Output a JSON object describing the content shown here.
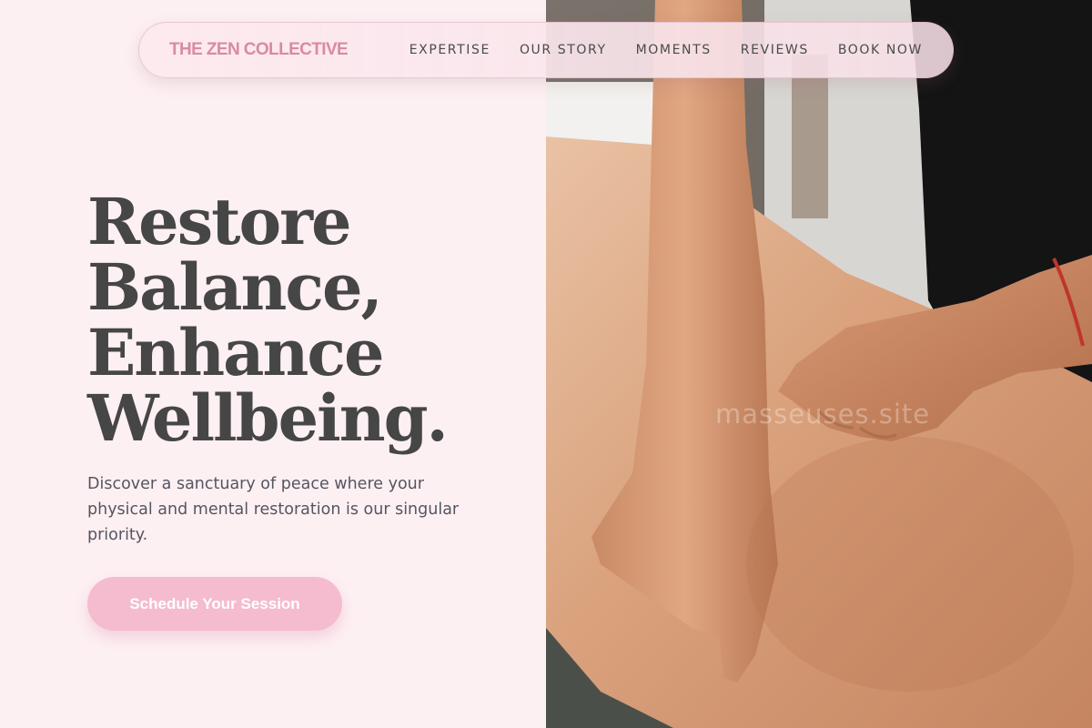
{
  "nav": {
    "brand": "THE ZEN COLLECTIVE",
    "links": [
      "EXPERTISE",
      "OUR STORY",
      "MOMENTS",
      "REVIEWS",
      "BOOK NOW"
    ]
  },
  "hero": {
    "title_lines": [
      "Restore",
      "Balance,",
      "Enhance",
      "Wellbeing."
    ],
    "description": "Discover a sanctuary of peace where your physical and mental restoration is our singular priority.",
    "cta_label": "Schedule Your Session"
  },
  "photo": {
    "watermark": "masseuses.site"
  },
  "colors": {
    "background": "#fdf0f3",
    "brand": "#d98aa5",
    "cta": "#f4bcce",
    "heading": "#464646",
    "body_text": "#555560"
  }
}
